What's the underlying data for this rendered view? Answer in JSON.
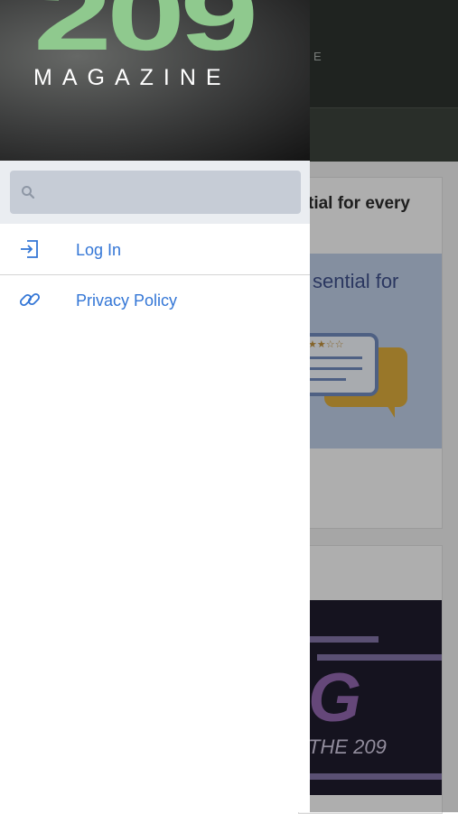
{
  "background": {
    "header_fragment": "E",
    "card1": {
      "title_fragment": "tial for every",
      "image_text_fragment": "sential for",
      "stars": "★★☆☆"
    },
    "card2": {
      "image_letter": "G",
      "image_caption": "THE 209"
    }
  },
  "drawer": {
    "logo": {
      "number": "209",
      "wordmark": "MAGAZINE"
    },
    "search": {
      "icon": "search-icon",
      "placeholder": ""
    },
    "menu": [
      {
        "label": "Log In",
        "icon": "login-icon"
      },
      {
        "label": "Privacy Policy",
        "icon": "link-icon"
      }
    ]
  },
  "colors": {
    "accent": "#3376d6",
    "logo_green": "#8fc98e",
    "search_bg": "#c6ccd6",
    "search_band": "#eaedf1"
  }
}
